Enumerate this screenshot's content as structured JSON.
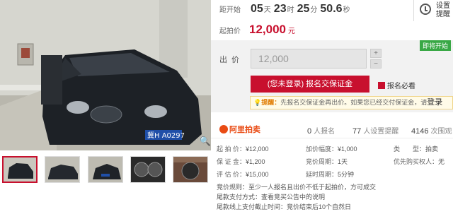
{
  "countdown": {
    "label": "距开始",
    "days": "05",
    "days_unit": "天",
    "hours": "23",
    "hours_unit": "时",
    "minutes": "25",
    "minutes_unit": "分",
    "seconds": "50.6",
    "seconds_unit": "秒"
  },
  "reminder": {
    "label": "设置提醒",
    "icon": "clock-icon"
  },
  "start_price": {
    "label": "起拍价",
    "value": "12,000",
    "unit": "元"
  },
  "bid": {
    "badge": "即将开始",
    "label": "出价",
    "input_value": "12,000",
    "plus": "+",
    "minus": "−",
    "signup_button": "(您未登录) 报名交保证金",
    "must_read": "报名必看",
    "tip_label": "提醒：",
    "tip_text": "先报名交保证金再出价。如果您已经交付保证金，请",
    "tip_login": "登录"
  },
  "platform": {
    "logo": "阿里拍卖",
    "signups_count": "0",
    "signups_label": "人报名",
    "reminders_count": "77",
    "reminders_label": "人设置提醒",
    "views_count": "4146",
    "views_label": "次围观"
  },
  "details": {
    "start_price": {
      "k": "起 拍 价：",
      "v": "¥12,000"
    },
    "increment": {
      "k": "加价幅度：",
      "v": "¥1,000"
    },
    "type": {
      "k": "类　　型：",
      "v": "拍卖"
    },
    "deposit": {
      "k": "保 证 金：",
      "v": "¥1,200"
    },
    "cycle": {
      "k": "竞价周期：",
      "v": "1天"
    },
    "priority": {
      "k": "优先购买权人：",
      "v": "无"
    },
    "valuation": {
      "k": "评 估 价：",
      "v": "¥15,000"
    },
    "delay": {
      "k": "延时周期：",
      "v": "5分钟"
    }
  },
  "rules": [
    "竞价规则：至少一人报名且出价不低于起拍价，方可成交",
    "尾款支付方式：查看竞买公告中的说明",
    "尾款线上支付截止时间：竞价结束后10个自然日"
  ],
  "colors": {
    "accent": "#c8102e",
    "badge_green": "#39a845",
    "ali_orange": "#e94b14"
  },
  "icons": {
    "zoom": "magnifier-icon",
    "must_read": "document-icon"
  }
}
